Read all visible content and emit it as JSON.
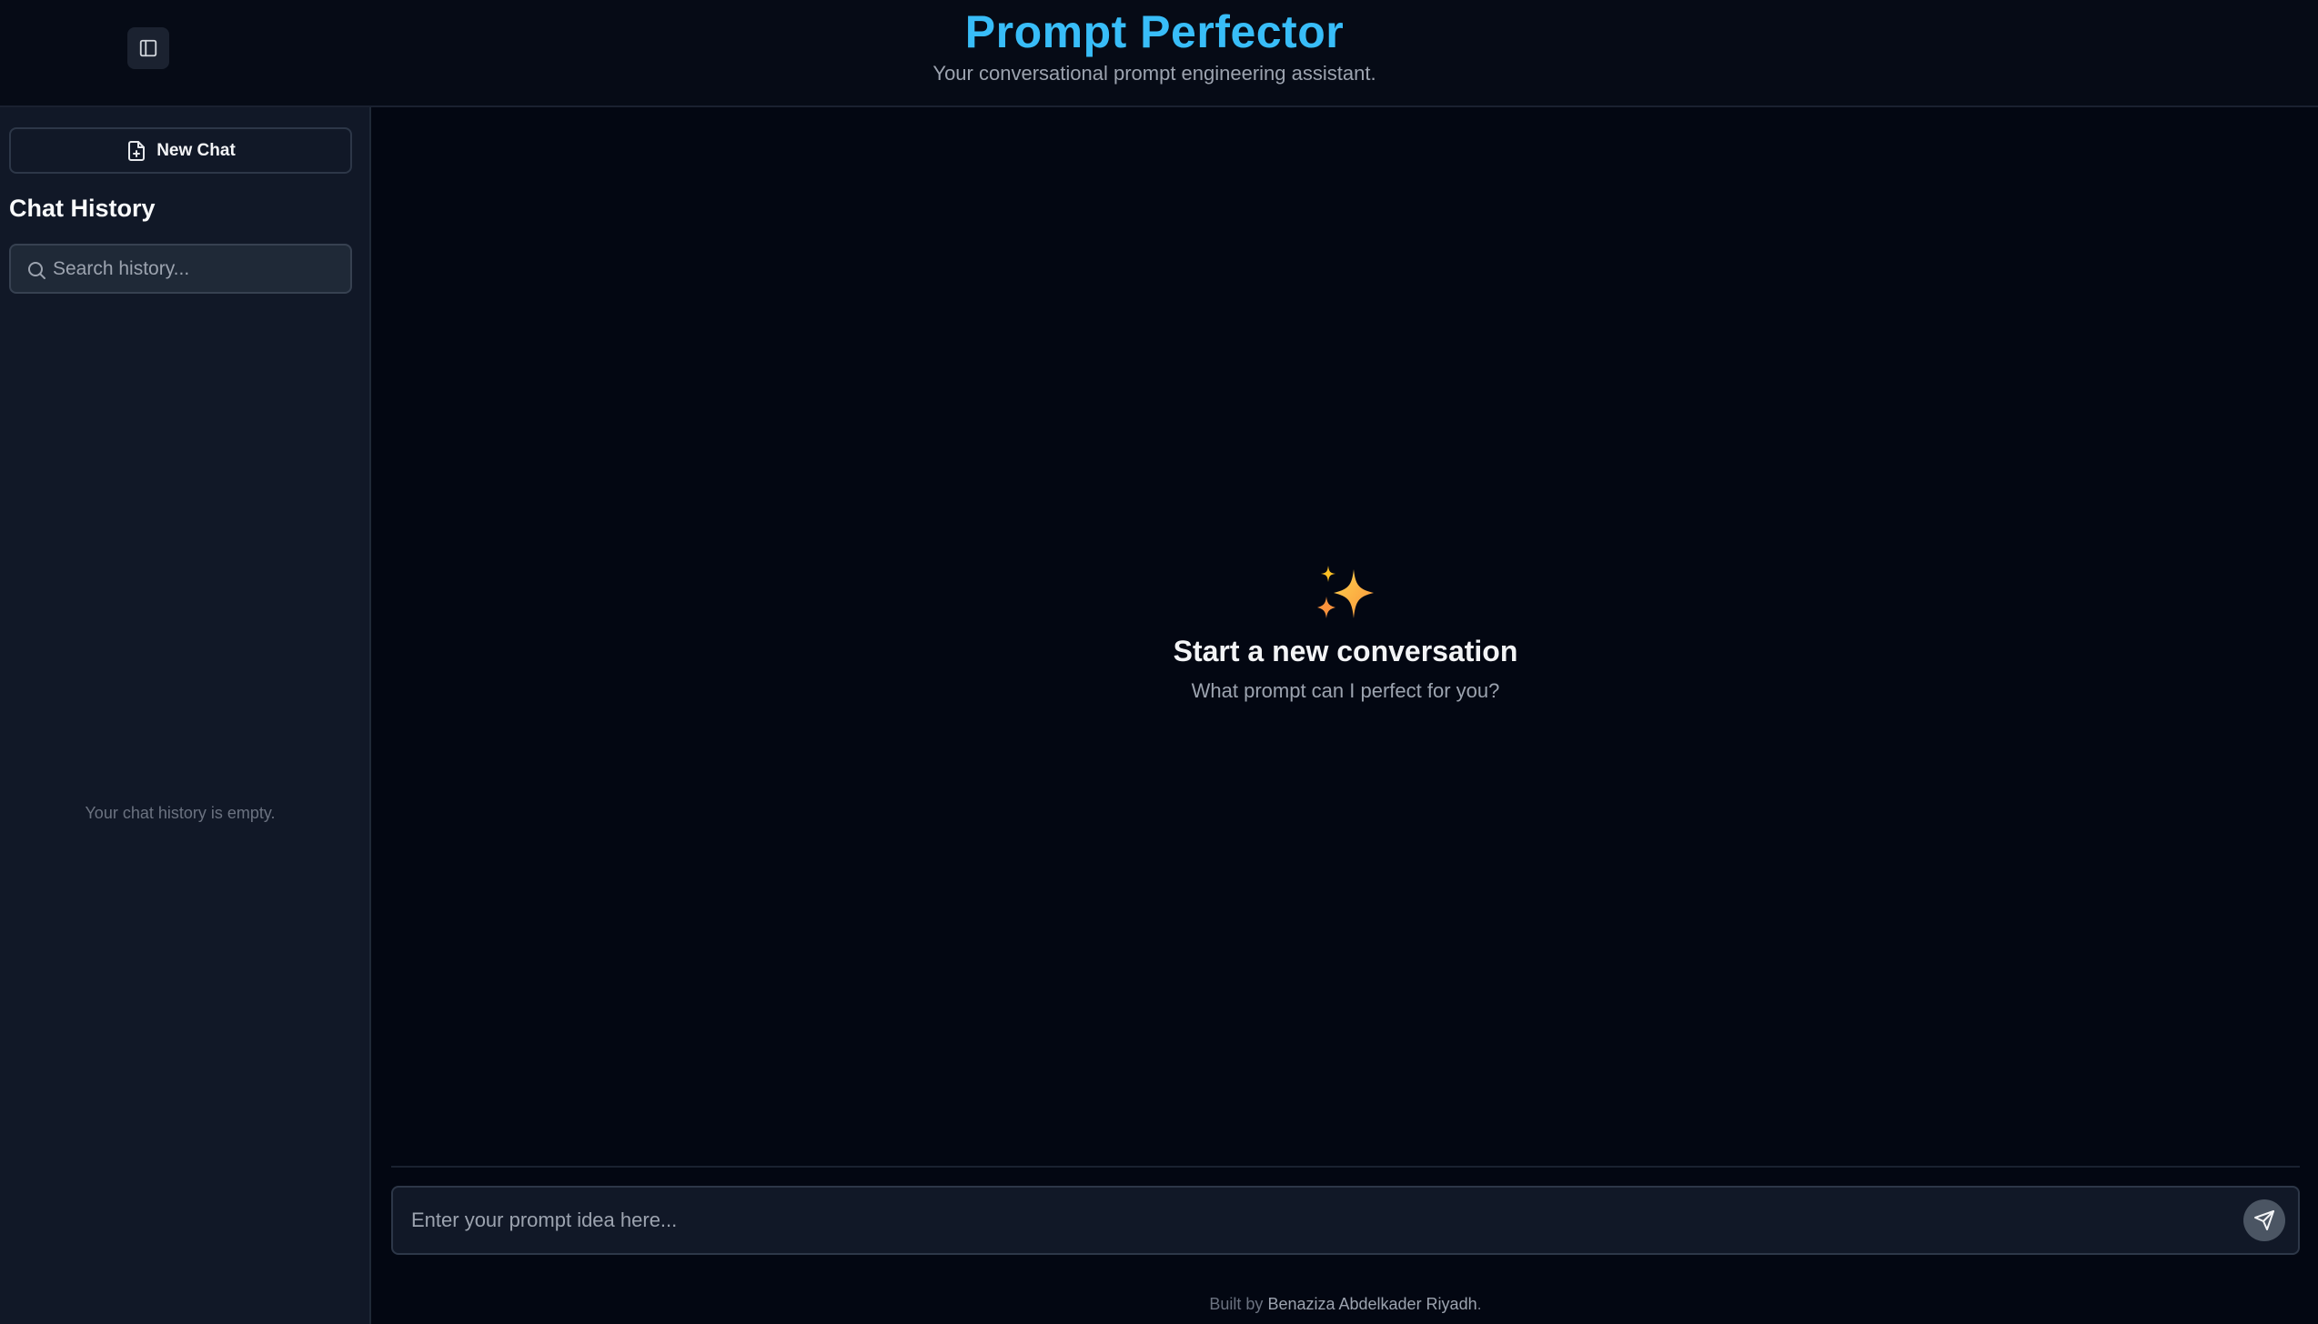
{
  "header": {
    "title": "Prompt Perfector",
    "subtitle": "Your conversational prompt engineering assistant.",
    "toggle_icon": "sidebar-toggle-icon"
  },
  "sidebar": {
    "new_chat_label": "New Chat",
    "new_chat_icon": "file-plus-icon",
    "history_title": "Chat History",
    "search_placeholder": "Search history...",
    "search_icon": "search-icon",
    "empty_text": "Your chat history is empty."
  },
  "main": {
    "welcome_icon": "sparkles-icon",
    "welcome_title": "Start a new conversation",
    "welcome_subtitle": "What prompt can I perfect for you?",
    "input_placeholder": "Enter your prompt idea here...",
    "send_icon": "send-icon"
  },
  "footer": {
    "prefix": "Built by",
    "author": "Benaziza Abdelkader Riyadh",
    "suffix": "."
  },
  "colors": {
    "accent": "#38bdf8",
    "background": "#030712",
    "sidebar": "#111827",
    "sparkle_gold": "#fbbf24",
    "sparkle_orange": "#f97316"
  }
}
